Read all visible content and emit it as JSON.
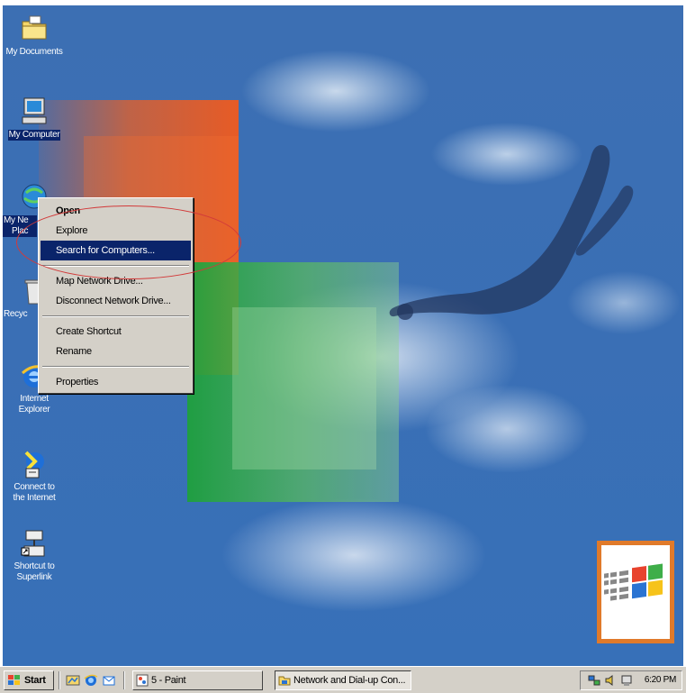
{
  "desktop": {
    "icons": [
      {
        "name": "my-documents",
        "label": "My Documents",
        "icon": "folder-icon"
      },
      {
        "name": "my-computer",
        "label": "My Computer",
        "icon": "computer-icon"
      },
      {
        "name": "my-network-places",
        "label_line1": "My Ne",
        "label_line2": "Plac",
        "icon": "network-icon"
      },
      {
        "name": "recycle-bin",
        "label": "Recyc",
        "icon": "recycle-bin-icon"
      },
      {
        "name": "internet-explorer",
        "label_line1": "Internet",
        "label_line2": "Explorer",
        "icon": "ie-icon"
      },
      {
        "name": "connect-internet",
        "label_line1": "Connect to",
        "label_line2": "the Internet",
        "icon": "connect-icon"
      },
      {
        "name": "shortcut-superlink",
        "label_line1": "Shortcut to",
        "label_line2": "Superlink",
        "icon": "shortcut-icon"
      }
    ]
  },
  "context_menu": {
    "items": [
      {
        "label": "Open",
        "bold": true
      },
      {
        "label": "Explore"
      },
      {
        "label": "Search for Computers...",
        "highlighted": true
      },
      {
        "label": "Map Network Drive..."
      },
      {
        "label": "Disconnect Network Drive..."
      },
      {
        "label": "Create Shortcut"
      },
      {
        "label": "Rename"
      },
      {
        "label": "Properties"
      }
    ]
  },
  "taskbar": {
    "start_label": "Start",
    "tasks": [
      {
        "label": "5 - Paint",
        "icon": "paint-icon"
      },
      {
        "label": "Network and Dial-up Con...",
        "icon": "network-folder-icon",
        "pressed": true
      }
    ],
    "clock": "6:20 PM"
  },
  "colors": {
    "desktop_blue": "#3a6fb5",
    "selection": "#0a246a",
    "menu_face": "#d4d0c8",
    "annotation": "#d23a3a"
  }
}
